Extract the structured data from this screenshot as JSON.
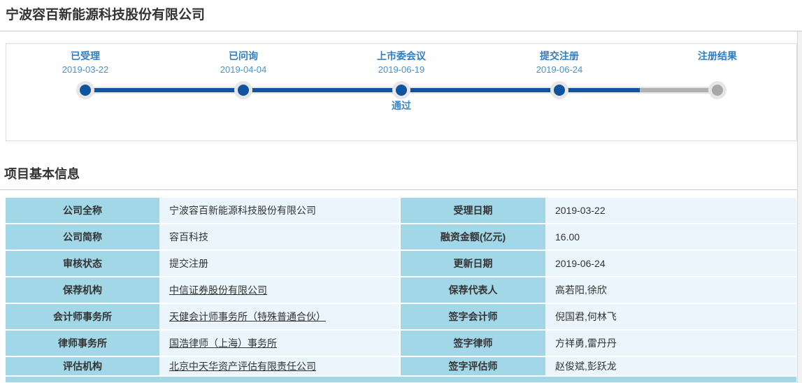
{
  "page": {
    "title": "宁波容百新能源科技股份有限公司"
  },
  "timeline": {
    "stages": [
      {
        "label": "已受理",
        "date": "2019-03-22",
        "status": "",
        "state": "done"
      },
      {
        "label": "已问询",
        "date": "2019-04-04",
        "status": "",
        "state": "done"
      },
      {
        "label": "上市委会议",
        "date": "2019-06-19",
        "status": "通过",
        "state": "done"
      },
      {
        "label": "提交注册",
        "date": "2019-06-24",
        "status": "",
        "state": "done"
      },
      {
        "label": "注册结果",
        "date": "",
        "status": "",
        "state": "pending"
      }
    ],
    "progress_percent": 87.7,
    "colors": {
      "done": "#0f549e",
      "pending": "#b1b1b1",
      "track": "#e6e6e6"
    }
  },
  "section": {
    "title": "项目基本信息"
  },
  "info_table": {
    "left": [
      {
        "label": "公司全称",
        "value": "宁波容百新能源科技股份有限公司",
        "link": false
      },
      {
        "label": "公司简称",
        "value": "容百科技",
        "link": false
      },
      {
        "label": "审核状态",
        "value": "提交注册",
        "link": false
      },
      {
        "label": "保荐机构",
        "value": "中信证券股份有限公司",
        "link": true
      },
      {
        "label": "会计师事务所",
        "value": "天健会计师事务所（特殊普通合伙）",
        "link": true
      },
      {
        "label": "律师事务所",
        "value": "国浩律师（上海）事务所",
        "link": true
      },
      {
        "label": "评估机构",
        "value": "北京中天华资产评估有限责任公司",
        "link": true
      }
    ],
    "right": [
      {
        "label": "受理日期",
        "value": "2019-03-22",
        "link": false
      },
      {
        "label": "融资金额(亿元)",
        "value": "16.00",
        "link": false
      },
      {
        "label": "更新日期",
        "value": "2019-06-24",
        "link": false
      },
      {
        "label": "保荐代表人",
        "value": "高若阳,徐欣",
        "link": false
      },
      {
        "label": "签字会计师",
        "value": "倪国君,何林飞",
        "link": false
      },
      {
        "label": "签字律师",
        "value": "方祥勇,雷丹丹",
        "link": false
      },
      {
        "label": "签字评估师",
        "value": "赵俊斌,彭跃龙",
        "link": false
      }
    ],
    "colors": {
      "label_bg": "#a2d7e7",
      "value_bg": "#eaf6fb"
    }
  }
}
